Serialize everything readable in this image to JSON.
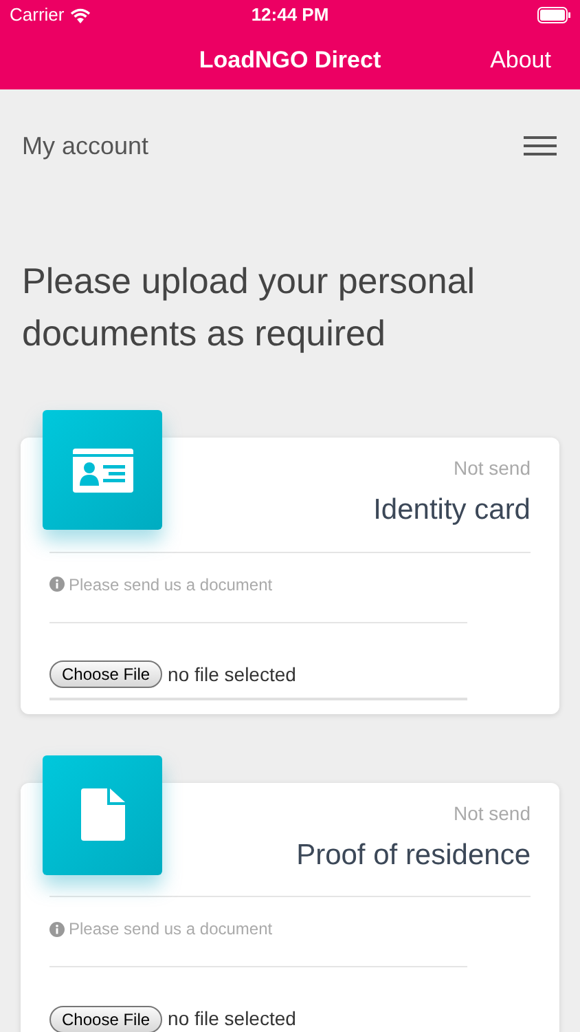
{
  "status_bar": {
    "carrier": "Carrier",
    "time": "12:44 PM"
  },
  "nav_bar": {
    "title": "LoadNGO Direct",
    "action": "About"
  },
  "header": {
    "title": "My account"
  },
  "heading": "Please upload your personal documents as required",
  "documents": [
    {
      "kind": "id-card",
      "status": "Not send",
      "title": "Identity card",
      "hint": "Please send us a document",
      "button": "Choose File",
      "file": "no file selected"
    },
    {
      "kind": "file",
      "status": "Not send",
      "title": "Proof of residence",
      "hint": "Please send us a document",
      "button": "Choose File",
      "file": "no file selected"
    }
  ]
}
